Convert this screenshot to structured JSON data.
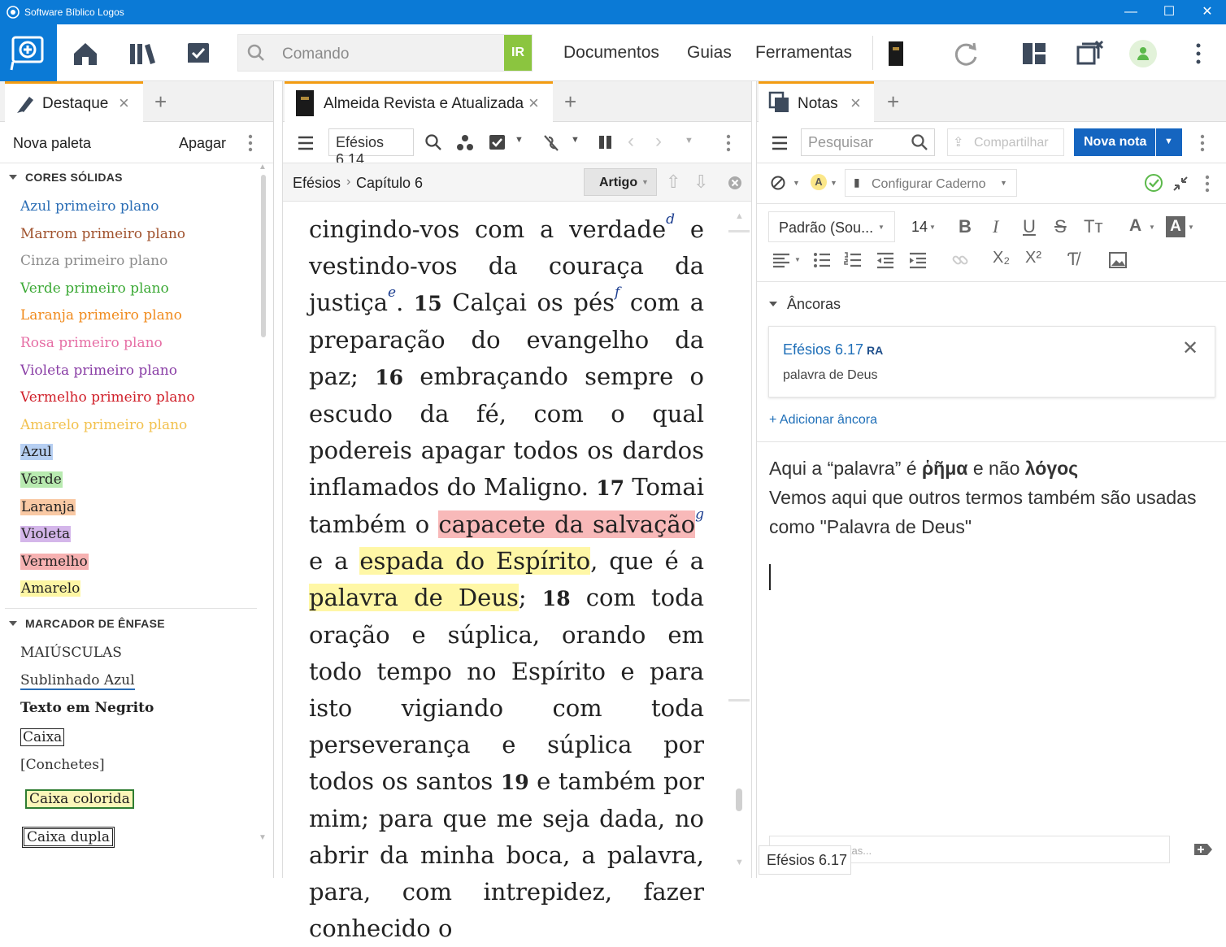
{
  "window": {
    "title": "Software Bíblico Logos",
    "minimize": "—",
    "maximize": "☐",
    "close": "✕"
  },
  "toolbar": {
    "command_placeholder": "Comando",
    "go_label": "IR",
    "menus": [
      "Documentos",
      "Guias",
      "Ferramentas"
    ]
  },
  "left_panel": {
    "tab_label": "Destaque",
    "new_palette": "Nova paleta",
    "delete": "Apagar",
    "solid_colors_header": "CORES SÓLIDAS",
    "solid_colors": [
      {
        "label": "Azul primeiro plano",
        "color": "#2a6db5"
      },
      {
        "label": "Marrom primeiro plano",
        "color": "#a0522d"
      },
      {
        "label": "Cinza primeiro plano",
        "color": "#8c8c8c"
      },
      {
        "label": "Verde primeiro plano",
        "color": "#3ba935"
      },
      {
        "label": "Laranja primeiro plano",
        "color": "#f08a1c"
      },
      {
        "label": "Rosa primeiro plano",
        "color": "#e66fa5"
      },
      {
        "label": "Violeta primeiro plano",
        "color": "#8a3fa6"
      },
      {
        "label": "Vermelho primeiro plano",
        "color": "#d0202a"
      },
      {
        "label": "Amarelo primeiro plano",
        "color": "#f2c14e"
      }
    ],
    "bg_colors": [
      {
        "label": "Azul",
        "color": "#b6cff2"
      },
      {
        "label": "Verde",
        "color": "#b8eab0"
      },
      {
        "label": "Laranja",
        "color": "#f9c9a4"
      },
      {
        "label": "Violeta",
        "color": "#d4b6ea"
      },
      {
        "label": "Vermelho",
        "color": "#f6b1b1"
      },
      {
        "label": "Amarelo",
        "color": "#fdf6a4"
      }
    ],
    "emphasis_header": "MARCADOR DE ÊNFASE",
    "emphasis": {
      "caps": "MAIÚSCULAS",
      "underline": "Sublinhado Azul",
      "bold": "Texto em Negrito",
      "box": "Caixa",
      "brackets": "[Conchetes]",
      "colored_box": "Caixa colorida",
      "double_box": "Caixa dupla"
    }
  },
  "mid_panel": {
    "tab_label": "Almeida Revista e Atualizada",
    "reference": "Efésios 6.14",
    "breadcrumb_book": "Efésios",
    "breadcrumb_sep": "›",
    "breadcrumb_chapter": "Capítulo 6",
    "article_label": "Artigo"
  },
  "text": {
    "p1": "cingindo-vos com a verdade",
    "fn_d": "d",
    "p2": " e vestindo-vos da couraça da justiça",
    "fn_e": "e",
    "p3": ".",
    "v15": "15",
    "p4": " Calçai os pés",
    "fn_f": "f",
    "p5": " com a preparação do evangelho da paz;",
    "v16": "16",
    "p6": " embraçando sempre o escudo da fé, com o qual podereis apagar todos os dardos inflamados do Maligno. ",
    "v17": "17",
    "p7": " Tomai também o ",
    "hl_red": "capacete da salvação",
    "fn_g": "g",
    "p8": " e a ",
    "hl_yellow1": "espada do Espírito",
    "p9": ", que é a ",
    "hl_yellow2": "palavra de Deus",
    "p10": ";",
    "v18": "18",
    "p11": " com toda oração e súplica, orando em todo tempo no Espírito e para isto vigiando com toda perseverança e súplica por todos os santos ",
    "v19": "19",
    "p12": " e também por mim; para que me seja dada, no abrir da minha boca, a palavra, para, com intrepidez, fazer conhecido o"
  },
  "right_panel": {
    "tab_label": "Notas",
    "search_placeholder": "Pesquisar",
    "share_label": "Compartilhar",
    "new_note_label": "Nova nota",
    "notebook_label": "Configurar Caderno",
    "font_label": "Padrão (Sou...",
    "font_size": "14",
    "anchors_header": "Âncoras",
    "anchor_ref": "Efésios 6.17",
    "anchor_version": "RA",
    "anchor_text": "palavra de Deus",
    "add_anchor": "+ Adicionar âncora",
    "note_line1_a": "Aqui a “palavra” é ",
    "note_line1_b": "ῥῆμα",
    "note_line1_c": " e não ",
    "note_line1_d": "λόγος",
    "note_line2": "Vemos aqui que outros termos também são usadas como \"Palavra de Deus\"",
    "tags_placeholder": "Adicione etiquetas...",
    "footer_ref": "Efésios 6.17"
  },
  "colors": {
    "accent": "#0b7ad6",
    "tab_active": "#f39c12",
    "go_green": "#8bc53f",
    "new_note_blue": "#1565c0"
  }
}
